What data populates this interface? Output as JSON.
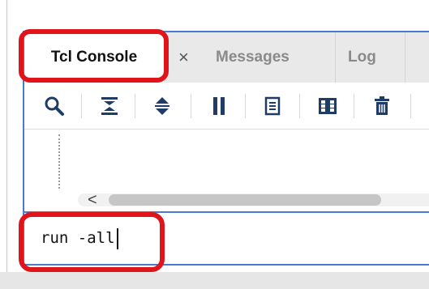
{
  "tabs": {
    "active_label": "Tcl Console",
    "close_glyph": "×",
    "messages_label": "Messages",
    "log_label": "Log"
  },
  "toolbar": {
    "icons": [
      "search-icon",
      "collapse-all-icon",
      "expand-all-icon",
      "pause-icon",
      "copy-icon",
      "columns-icon",
      "trash-icon"
    ]
  },
  "scroll": {
    "arrow": "<"
  },
  "console": {
    "command_value": "run -all"
  },
  "colors": {
    "panel_border": "#4a7bd0",
    "highlight": "#e0141b"
  }
}
